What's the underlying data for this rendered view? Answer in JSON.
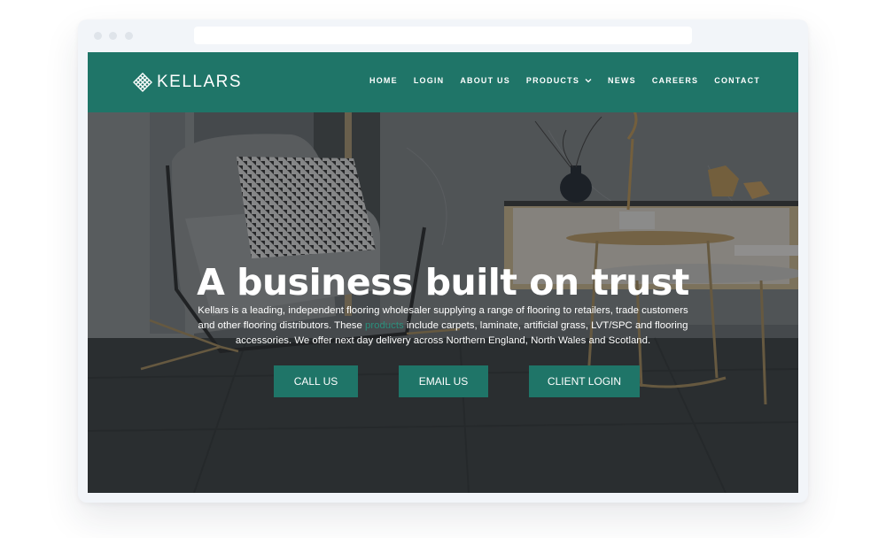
{
  "browser": {
    "window_dots": [
      "close",
      "minimize",
      "maximize"
    ],
    "address_bar": ""
  },
  "header": {
    "logo_text": "KELLARS",
    "logo_icon": "woven-diamond-logo",
    "nav": [
      {
        "label": "HOME"
      },
      {
        "label": "LOGIN"
      },
      {
        "label": "ABOUT US"
      },
      {
        "label": "PRODUCTS",
        "has_dropdown": true
      },
      {
        "label": "NEWS"
      },
      {
        "label": "CAREERS"
      },
      {
        "label": "CONTACT"
      }
    ]
  },
  "hero": {
    "headline": "A business built on trust",
    "intro_before": "Kellars is a leading, independent flooring wholesaler supplying a range of flooring to retailers, trade customers and other flooring distributors. These ",
    "intro_link": "products",
    "intro_after": " include carpets, laminate, artificial grass, LVT/SPC and flooring accessories. We offer next day delivery across Northern England, North Wales and Scotland.",
    "buttons": {
      "call": "CALL US",
      "email": "EMAIL US",
      "client_login": "CLIENT LOGIN"
    }
  },
  "colors": {
    "brand_green": "#1f7568",
    "link_green": "#2a8f7c",
    "page_bg": "#ffffff",
    "frame_bg": "#f2f5f9"
  }
}
